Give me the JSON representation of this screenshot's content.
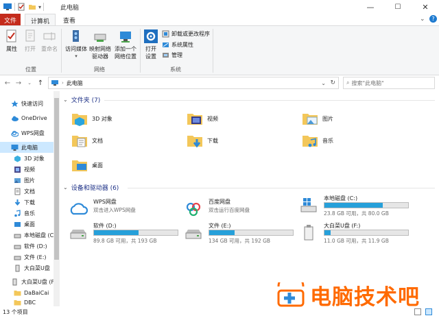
{
  "window": {
    "title": "此电脑",
    "controls": {
      "minimize": "—",
      "maximize": "☐",
      "close": "✕"
    }
  },
  "ribbon_tabs": [
    {
      "label": "文件"
    },
    {
      "label": "计算机"
    },
    {
      "label": "查看"
    }
  ],
  "ribbon": {
    "location_group": {
      "label": "位置",
      "buttons": [
        {
          "label": "属性",
          "icon": "properties-icon"
        },
        {
          "label": "打开",
          "icon": "open-icon"
        },
        {
          "label": "重命名",
          "icon": "rename-icon"
        }
      ]
    },
    "network_group": {
      "label": "网络",
      "buttons": [
        {
          "label": "访问媒体",
          "icon": "media-server-icon"
        },
        {
          "label": "映射网络\n驱动器",
          "icon": "map-drive-icon"
        },
        {
          "label": "添加一个\n网络位置",
          "icon": "network-location-icon"
        }
      ]
    },
    "system_group": {
      "label": "系统",
      "buttons": [
        {
          "label": "打开\n设置",
          "icon": "settings-icon"
        }
      ],
      "small_buttons": [
        {
          "label": "卸载或更改程序",
          "icon": "uninstall-icon"
        },
        {
          "label": "系统属性",
          "icon": "system-properties-icon"
        },
        {
          "label": "管理",
          "icon": "manage-icon"
        }
      ]
    }
  },
  "address": {
    "path": "此电脑",
    "search_placeholder": "搜索\"此电脑\""
  },
  "sidebar": {
    "items": [
      {
        "label": "快速访问",
        "icon": "star-icon"
      },
      {
        "label": "OneDrive",
        "icon": "cloud-icon"
      },
      {
        "label": "WPS网盘",
        "icon": "wps-cloud-icon"
      },
      {
        "label": "此电脑",
        "icon": "pc-icon",
        "selected": true
      },
      {
        "label": "3D 对象",
        "icon": "3d-icon"
      },
      {
        "label": "视频",
        "icon": "video-icon"
      },
      {
        "label": "图片",
        "icon": "picture-icon"
      },
      {
        "label": "文档",
        "icon": "document-icon"
      },
      {
        "label": "下载",
        "icon": "download-icon"
      },
      {
        "label": "音乐",
        "icon": "music-icon"
      },
      {
        "label": "桌面",
        "icon": "desktop-icon"
      },
      {
        "label": "本地磁盘 (C",
        "icon": "drive-icon"
      },
      {
        "label": "软件 (D:)",
        "icon": "drive-icon"
      },
      {
        "label": "文件 (E:)",
        "icon": "drive-icon"
      },
      {
        "label": "大白菜U盘",
        "icon": "usb-icon"
      },
      {
        "label": "大白菜U盘 (F",
        "icon": "usb-icon"
      },
      {
        "label": "DaBaiCai",
        "icon": "folder-icon"
      },
      {
        "label": "DBC",
        "icon": "folder-icon"
      }
    ]
  },
  "folders_section": {
    "title": "文件夹 (7)",
    "items": [
      {
        "label": "3D 对象",
        "icon": "3d-objects-folder-icon"
      },
      {
        "label": "视频",
        "icon": "videos-folder-icon"
      },
      {
        "label": "图片",
        "icon": "pictures-folder-icon"
      },
      {
        "label": "文档",
        "icon": "documents-folder-icon"
      },
      {
        "label": "下载",
        "icon": "downloads-folder-icon"
      },
      {
        "label": "音乐",
        "icon": "music-folder-icon"
      },
      {
        "label": "桌面",
        "icon": "desktop-folder-icon"
      }
    ]
  },
  "drives_section": {
    "title": "设备和驱动器 (6)",
    "items": [
      {
        "name": "WPS网盘",
        "subtitle": "双击进入WPS网盘",
        "icon": "wps-cloud-drive-icon"
      },
      {
        "name": "百度网盘",
        "subtitle": "双击运行百度网盘",
        "icon": "baidu-drive-icon"
      },
      {
        "name": "本地磁盘 (C:)",
        "free": "23.8 GB 可用，共 80.0 GB",
        "used_fraction": 0.7,
        "icon": "windows-drive-icon"
      },
      {
        "name": "软件 (D:)",
        "free": "89.8 GB 可用，共 193 GB",
        "used_fraction": 0.53,
        "icon": "hdd-icon"
      },
      {
        "name": "文件 (E:)",
        "free": "134 GB 可用，共 192 GB",
        "used_fraction": 0.3,
        "icon": "hdd-icon"
      },
      {
        "name": "大白菜U盘 (F:)",
        "free": "11.0 GB 可用，共 11.9 GB",
        "used_fraction": 0.07,
        "icon": "usb-drive-icon"
      }
    ]
  },
  "status": {
    "text": "13 个项目"
  },
  "watermark": {
    "text": "电脑技术吧"
  },
  "colors": {
    "accent": "#26a0da",
    "file_tab": "#c42b1c",
    "selected": "#cce8ff",
    "watermark": "#ff6a00"
  }
}
